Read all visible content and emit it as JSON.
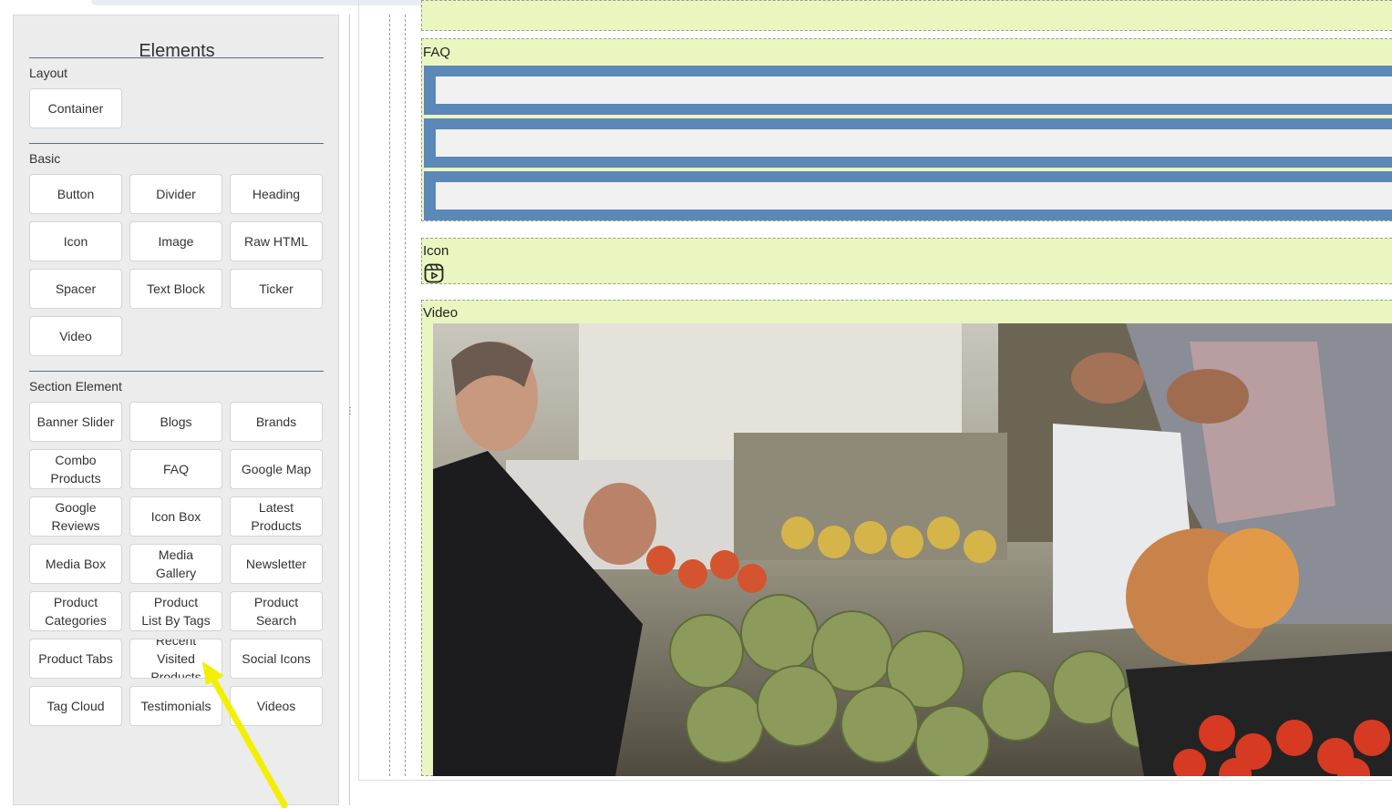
{
  "sidebar": {
    "title": "Elements",
    "sections": [
      {
        "label": "Layout",
        "items": [
          "Container"
        ]
      },
      {
        "label": "Basic",
        "items": [
          "Button",
          "Divider",
          "Heading",
          "Icon",
          "Image",
          "Raw HTML",
          "Spacer",
          "Text Block",
          "Ticker",
          "Video"
        ]
      },
      {
        "label": "Section Element",
        "items": [
          "Banner Slider",
          "Blogs",
          "Brands",
          "Combo\nProducts",
          "FAQ",
          "Google Map",
          "Google\nReviews",
          "Icon Box",
          "Latest\nProducts",
          "Media Box",
          "Media\nGallery",
          "Newsletter",
          "Product\nCategories",
          "Product\nList By Tags",
          "Product\nSearch",
          "Product Tabs",
          "Recent\nVisited\nProducts",
          "Social Icons",
          "Tag Cloud",
          "Testimonials",
          "Videos"
        ]
      }
    ]
  },
  "canvas": {
    "blocks": {
      "faq_label": "FAQ",
      "icon_label": "Icon",
      "video_label": "Video"
    },
    "faq_item_count": 3,
    "icon_name": "video-reel-icon"
  },
  "colors": {
    "block_bg": "#eaf6bf",
    "faq_bar": "#5b88b8",
    "top_bar": "#6aa76d",
    "annotation_arrow": "#f2f000"
  }
}
